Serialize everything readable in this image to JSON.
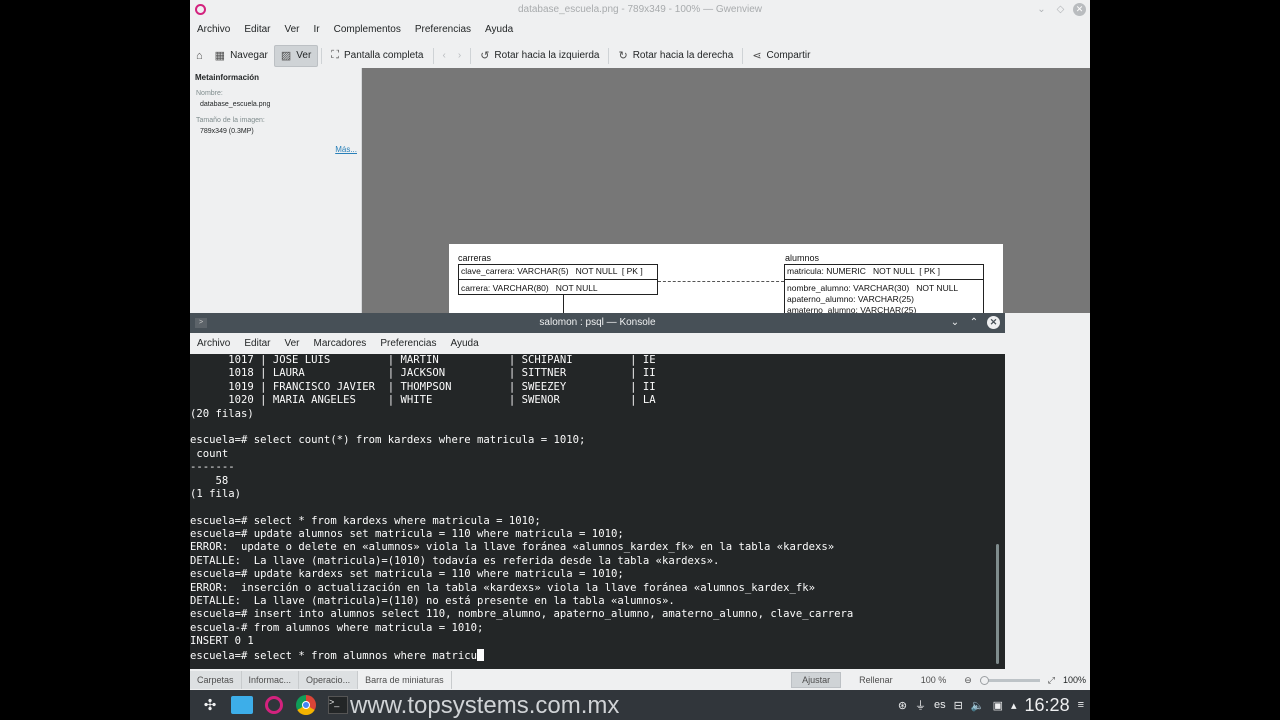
{
  "gwenview": {
    "title": "database_escuela.png - 789x349 - 100% — Gwenview",
    "menu": [
      "Archivo",
      "Editar",
      "Ver",
      "Ir",
      "Complementos",
      "Preferencias",
      "Ayuda"
    ],
    "toolbar": {
      "navegar": "Navegar",
      "ver": "Ver",
      "pantalla_completa": "Pantalla completa",
      "rotar_izq": "Rotar hacia la izquierda",
      "rotar_der": "Rotar hacia la derecha",
      "compartir": "Compartir"
    },
    "sidebar": {
      "heading": "Metainformación",
      "nombre_label": "Nombre:",
      "nombre_value": "database_escuela.png",
      "tamano_label": "Tamaño de la imagen:",
      "tamano_value": "789x349 (0.3MP)",
      "mas": "Más..."
    },
    "diagram": {
      "carreras_title": "carreras",
      "carreras_rows": [
        "clave_carrera: VARCHAR(5)   NOT NULL  [ PK ]",
        "carrera: VARCHAR(80)   NOT NULL"
      ],
      "alumnos_title": "alumnos",
      "alumnos_rows": [
        "matricula: NUMERIC   NOT NULL  [ PK ]",
        "nombre_alumno: VARCHAR(30)   NOT NULL",
        "apaterno_alumno: VARCHAR(25)",
        "amaterno_alumno: VARCHAR(25)"
      ]
    },
    "status": {
      "tabs": [
        "Carpetas",
        "Informac...",
        "Operacio..."
      ],
      "thumbnails": "Barra de miniaturas",
      "ajustar": "Ajustar",
      "rellenar": "Rellenar",
      "zoom_combo": "100 %",
      "zoom_label": "100%"
    }
  },
  "konsole": {
    "title": "salomon : psql — Konsole",
    "menu": [
      "Archivo",
      "Editar",
      "Ver",
      "Marcadores",
      "Preferencias",
      "Ayuda"
    ],
    "lines": [
      "      1017 | JOSE LUIS         | MARTIN           | SCHIPANI         | IE",
      "      1018 | LAURA             | JACKSON          | SITTNER          | II",
      "      1019 | FRANCISCO JAVIER  | THOMPSON         | SWEEZEY          | II",
      "      1020 | MARIA ANGELES     | WHITE            | SWENOR           | LA",
      "(20 filas)",
      "",
      "escuela=# select count(*) from kardexs where matricula = 1010;",
      " count",
      "-------",
      "    58",
      "(1 fila)",
      "",
      "escuela=# select * from kardexs where matricula = 1010;",
      "escuela=# update alumnos set matricula = 110 where matricula = 1010;",
      "ERROR:  update o delete en «alumnos» viola la llave foránea «alumnos_kardex_fk» en la tabla «kardexs»",
      "DETALLE:  La llave (matricula)=(1010) todavía es referida desde la tabla «kardexs».",
      "escuela=# update kardexs set matricula = 110 where matricula = 1010;",
      "ERROR:  inserción o actualización en la tabla «kardexs» viola la llave foránea «alumnos_kardex_fk»",
      "DETALLE:  La llave (matricula)=(110) no está presente en la tabla «alumnos».",
      "escuela=# insert into alumnos select 110, nombre_alumno, apaterno_alumno, amaterno_alumno, clave_carrera",
      "escuela-# from alumnos where matricula = 1010;",
      "INSERT 0 1"
    ],
    "prompt_line": "escuela=# select * from alumnos where matricu"
  },
  "taskbar": {
    "watermark": "www.topsystems.com.mx",
    "lang": "es",
    "clock": "16:28"
  }
}
